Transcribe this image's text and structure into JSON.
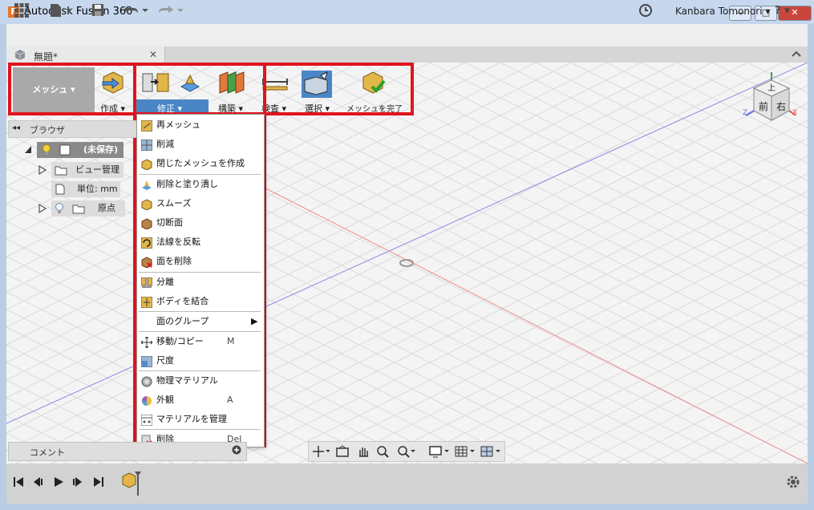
{
  "window": {
    "title": "Autodesk Fusion 360",
    "logo": "F",
    "buttons": {
      "minimize": "—",
      "maximize": "□",
      "close": "✕"
    }
  },
  "menubar": {
    "user": "Kanbara Tomonori ▾",
    "help": "? ▾"
  },
  "document_tab": {
    "label": "無題*",
    "close": "✕"
  },
  "toolbar": {
    "workspace": "メッシュ ▾",
    "groups": [
      {
        "label": "作成 ▾"
      },
      {
        "label": "修正 ▾"
      },
      {
        "label": "構築 ▾"
      },
      {
        "label": "検査 ▾"
      },
      {
        "label": "選択 ▾"
      },
      {
        "label": "メッシュを完了"
      }
    ]
  },
  "viewcube": {
    "top": "上",
    "front": "前",
    "right": "右",
    "axis_x": "X",
    "axis_y": "Y",
    "axis_z": "Z"
  },
  "browser": {
    "title": "ブラウザ",
    "root": "(未保存)",
    "items": [
      {
        "label": "ビュー管理"
      },
      {
        "label": "単位: mm"
      },
      {
        "label": "原点"
      }
    ]
  },
  "modify_menu": {
    "items": [
      {
        "label": "再メッシュ",
        "shortcut": ""
      },
      {
        "label": "削減",
        "shortcut": ""
      },
      {
        "label": "閉じたメッシュを作成",
        "shortcut": ""
      },
      {
        "label": "削除と塗り潰し",
        "shortcut": ""
      },
      {
        "label": "スムーズ",
        "shortcut": ""
      },
      {
        "label": "切断面",
        "shortcut": ""
      },
      {
        "label": "法線を反転",
        "shortcut": ""
      },
      {
        "label": "面を削除",
        "shortcut": ""
      },
      {
        "label": "分離",
        "shortcut": ""
      },
      {
        "label": "ボディを結合",
        "shortcut": ""
      },
      {
        "label": "面のグループ",
        "shortcut": ""
      },
      {
        "label": "移動/コピー",
        "shortcut": "M"
      },
      {
        "label": "尺度",
        "shortcut": ""
      },
      {
        "label": "物理マテリアル",
        "shortcut": ""
      },
      {
        "label": "外観",
        "shortcut": "A"
      },
      {
        "label": "マテリアルを管理",
        "shortcut": ""
      },
      {
        "label": "削除",
        "shortcut": "Del"
      }
    ]
  },
  "comment": {
    "label": "コメント"
  },
  "colors": {
    "highlight_red": "#e0141e",
    "selected_tab": "#4a86c6",
    "axis_blue": "#6a6af0",
    "axis_red": "#f07070"
  }
}
